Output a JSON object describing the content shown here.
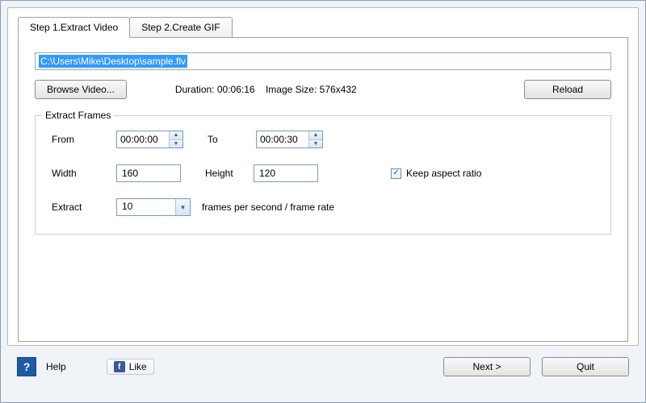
{
  "tabs": {
    "step1": "Step 1.Extract Video",
    "step2": "Step 2.Create GIF"
  },
  "path": "C:\\Users\\Mike\\Desktop\\sample.flv",
  "buttons": {
    "browse": "Browse Video...",
    "reload": "Reload",
    "next": "Next >",
    "quit": "Quit"
  },
  "info": {
    "duration_label": "Duration:",
    "duration_value": "00:06:16",
    "size_label": "Image Size:",
    "size_value": "576x432"
  },
  "fieldset": {
    "legend": "Extract Frames",
    "from_label": "From",
    "from_value": "00:00:00",
    "to_label": "To",
    "to_value": "00:00:30",
    "width_label": "Width",
    "width_value": "160",
    "height_label": "Height",
    "height_value": "120",
    "keep_aspect_label": "Keep aspect ratio",
    "keep_aspect_checked": true,
    "extract_label": "Extract",
    "extract_value": "10",
    "extract_after": "frames per second / frame rate"
  },
  "bottom": {
    "help": "Help",
    "like": "Like"
  }
}
